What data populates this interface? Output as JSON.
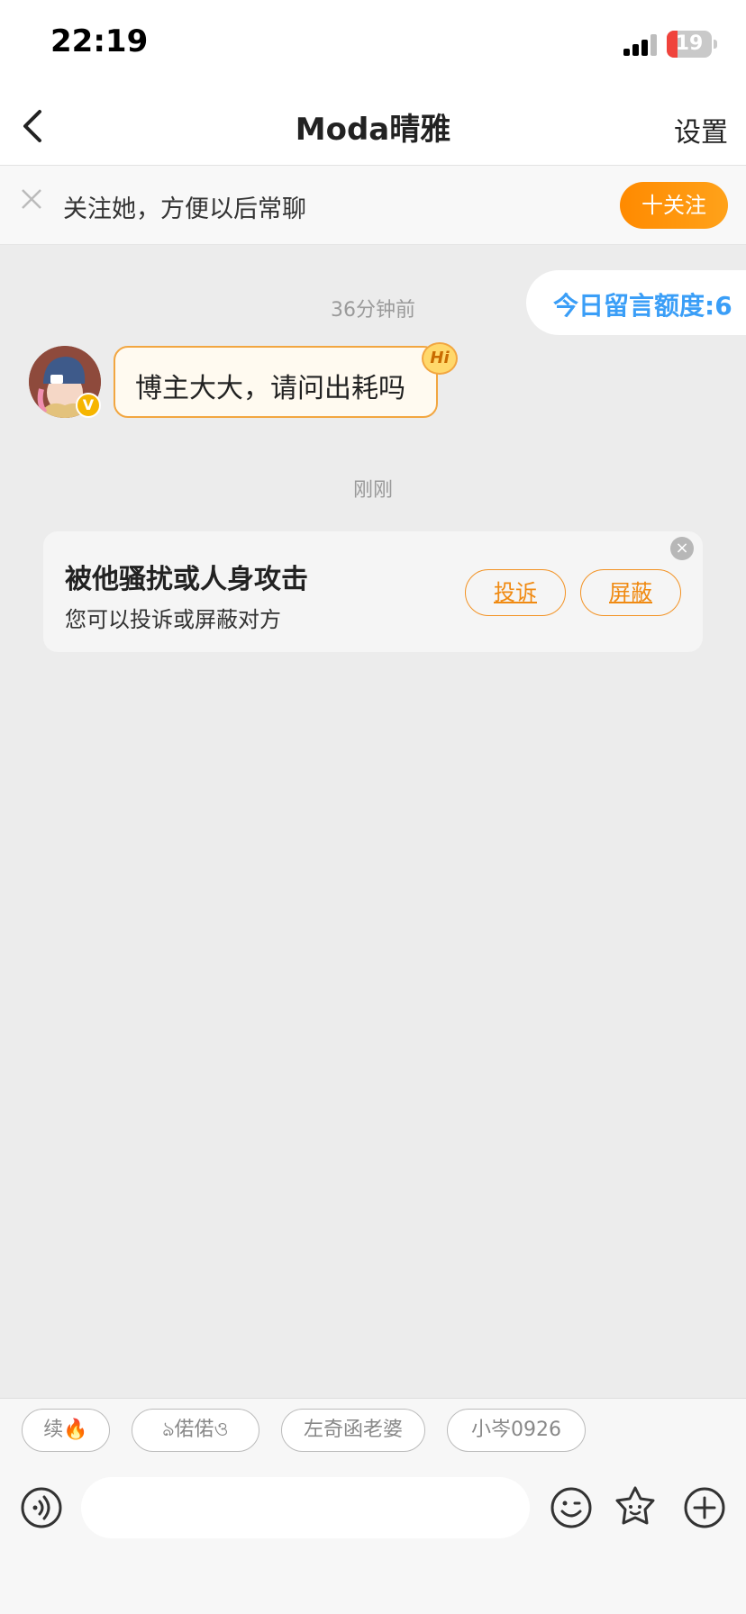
{
  "status_bar": {
    "time": "22:19",
    "battery": "19"
  },
  "nav": {
    "title": "Moda晴雅",
    "settings_label": "设置"
  },
  "follow_bar": {
    "text": "关注她，方便以后常聊",
    "button_label": "十关注"
  },
  "quota": {
    "text": "今日留言额度:6"
  },
  "messages": {
    "timestamp_1": "36分钟前",
    "incoming_text": "博主大大，请问出耗吗",
    "hi_badge": "Hi",
    "avatar_badge": "V",
    "timestamp_2": "刚刚"
  },
  "harass_card": {
    "title": "被他骚扰或人身攻击",
    "subtitle": "您可以投诉或屏蔽对方",
    "report_label": "投诉",
    "block_label": "屏蔽",
    "close": "×"
  },
  "quick_chips": [
    "续🔥",
    "ঌ偌偌ও",
    "左奇函老婆",
    "小岑0926"
  ],
  "input": {
    "placeholder": ""
  },
  "colors": {
    "accent_orange": "#ff8a00",
    "quota_blue": "#3a9ef7",
    "background": "#ececec"
  },
  "icons": {
    "back": "chevron-left-icon",
    "follow_close": "close-icon",
    "voice": "voice-icon",
    "emoji": "emoji-icon",
    "sticker": "sticker-icon",
    "plus": "plus-icon"
  }
}
